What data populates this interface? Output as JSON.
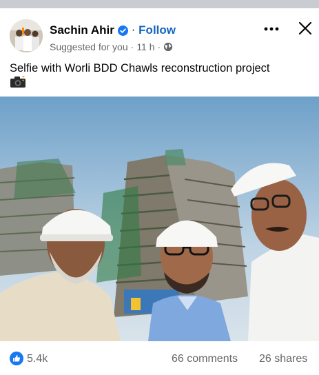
{
  "post": {
    "author": "Sachin Ahir",
    "follow_label": "Follow",
    "dot": "·",
    "suggested": "Suggested for you",
    "time": "11 h",
    "caption": "Selfie with Worli BDD Chawls reconstruction project",
    "likes": "5.4k",
    "comments": "66 comments",
    "shares": "26 shares"
  },
  "icons": {
    "verified": "verified-badge-icon",
    "globe": "globe-icon",
    "more": "more-options-icon",
    "close": "close-icon",
    "camera": "camera-emoji",
    "like": "like-reaction-icon"
  },
  "colors": {
    "accent": "#1565c0",
    "like": "#1877f2",
    "secondary_text": "#65676b",
    "primary_text": "#050505"
  }
}
